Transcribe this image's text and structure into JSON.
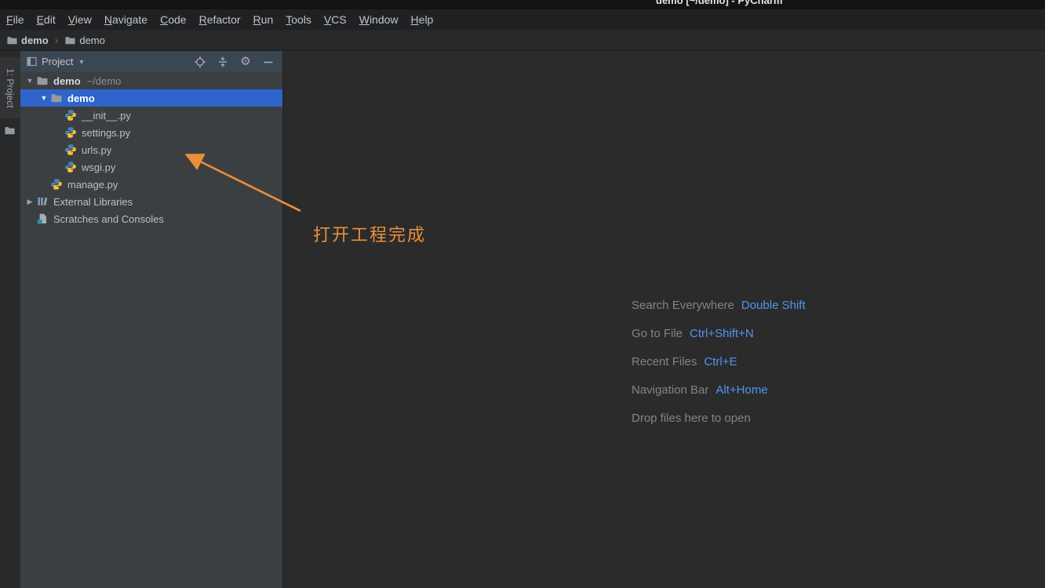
{
  "title_bar": {
    "title": "demo [~/demo] - PyCharm"
  },
  "menu_bar": {
    "items": [
      "File",
      "Edit",
      "View",
      "Navigate",
      "Code",
      "Refactor",
      "Run",
      "Tools",
      "VCS",
      "Window",
      "Help"
    ]
  },
  "breadcrumbs": {
    "items": [
      {
        "label": "demo"
      },
      {
        "label": "demo"
      }
    ]
  },
  "left_strip": {
    "tool_button_label": "1: Project"
  },
  "project_panel": {
    "header": {
      "title": "Project"
    },
    "tree": [
      {
        "label": "demo",
        "suffix": "~/demo"
      },
      {
        "label": "demo"
      },
      {
        "label": "__init__.py"
      },
      {
        "label": "settings.py"
      },
      {
        "label": "urls.py"
      },
      {
        "label": "wsgi.py"
      },
      {
        "label": "manage.py"
      },
      {
        "label": "External Libraries"
      },
      {
        "label": "Scratches and Consoles"
      }
    ]
  },
  "editor": {
    "annotation_text": "打开工程完成",
    "shortcuts": [
      {
        "action": "Search Everywhere",
        "keys": "Double Shift"
      },
      {
        "action": "Go to File",
        "keys": "Ctrl+Shift+N"
      },
      {
        "action": "Recent Files",
        "keys": "Ctrl+E"
      },
      {
        "action": "Navigation Bar",
        "keys": "Alt+Home"
      },
      {
        "action": "Drop files here to open",
        "keys": ""
      }
    ]
  },
  "colors": {
    "selection_blue": "#2f65ca",
    "shortcut_key_blue": "#5394ec",
    "annotation_orange": "#ec8e3a",
    "panel_background": "#3c3f41",
    "editor_background": "#2b2b2b"
  }
}
